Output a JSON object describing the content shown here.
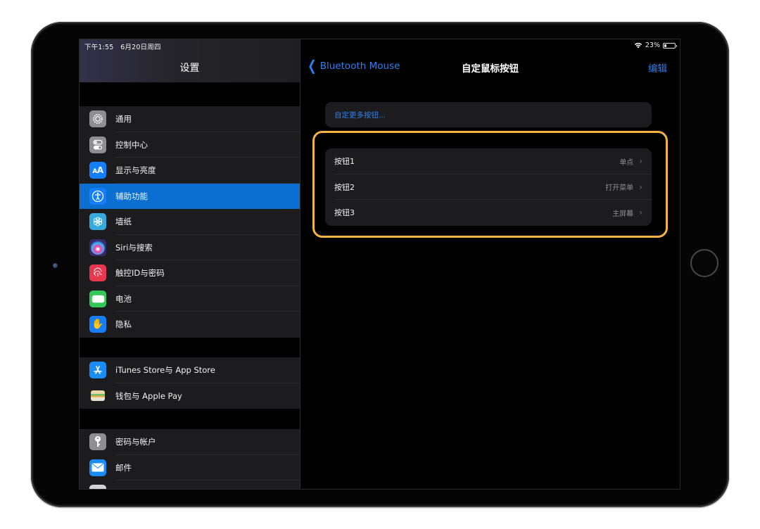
{
  "status_bar": {
    "time": "下午1:55",
    "date": "6月20日周四",
    "battery_percent_label": "23%",
    "battery_level": 0.23,
    "wifi_icon": "wifi-icon"
  },
  "sidebar": {
    "title": "设置",
    "groups": [
      {
        "items": [
          {
            "label": "通用",
            "icon": "gear-icon",
            "color": "#8e8e93",
            "selected": false
          },
          {
            "label": "控制中心",
            "icon": "toggles-icon",
            "color": "#8e8e93",
            "selected": false
          },
          {
            "label": "显示与亮度",
            "icon": "text-size-icon",
            "color": "#147efb",
            "selected": false
          },
          {
            "label": "辅助功能",
            "icon": "accessibility-icon",
            "color": "#147efb",
            "selected": true
          },
          {
            "label": "墙纸",
            "icon": "wallpaper-flower-icon",
            "color": "#36aadc",
            "selected": false
          },
          {
            "label": "Siri与搜索",
            "icon": "siri-icon",
            "color": "#3a2a6a",
            "selected": false
          },
          {
            "label": "触控ID与密码",
            "icon": "fingerprint-icon",
            "color": "#e6374f",
            "selected": false
          },
          {
            "label": "电池",
            "icon": "battery-icon",
            "color": "#34c759",
            "selected": false
          },
          {
            "label": "隐私",
            "icon": "hand-icon",
            "color": "#147efb",
            "selected": false
          }
        ]
      },
      {
        "items": [
          {
            "label": "iTunes Store与 App Store",
            "icon": "app-store-icon",
            "color": "#1a8cf6",
            "selected": false
          },
          {
            "label": "钱包与 Apple Pay",
            "icon": "wallet-icon",
            "color": "#1c1c1e",
            "selected": false
          }
        ]
      },
      {
        "items": [
          {
            "label": "密码与帐户",
            "icon": "key-icon",
            "color": "#8e8e93",
            "selected": false
          },
          {
            "label": "邮件",
            "icon": "mail-icon",
            "color": "#1a8cf6",
            "selected": false
          },
          {
            "label": "",
            "icon": "contacts-icon",
            "color": "#d1d1d6",
            "selected": false
          }
        ]
      }
    ]
  },
  "detail": {
    "back_label": "Bluetooth Mouse",
    "title": "自定鼠标按钮",
    "edit_label": "编辑",
    "more_buttons_label": "自定更多按钮...",
    "buttons": [
      {
        "name": "按钮1",
        "value": "单点"
      },
      {
        "name": "按钮2",
        "value": "打开菜单"
      },
      {
        "name": "按钮3",
        "value": "主屏幕"
      }
    ],
    "highlight_color": "#f4b343"
  },
  "colors": {
    "accent": "#2d7ff0",
    "selected_row": "#0a6fd0",
    "cell_background": "#1c1c1e"
  }
}
